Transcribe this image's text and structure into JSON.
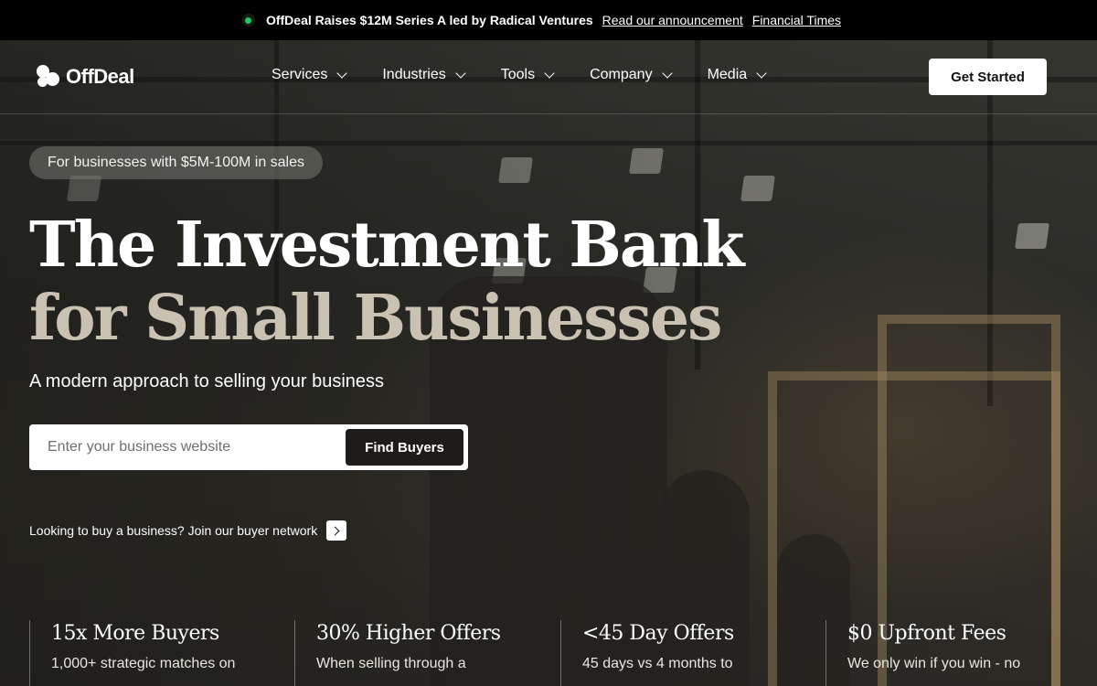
{
  "announcement": {
    "headline": "OffDeal Raises $12M Series A led by Radical Ventures",
    "link1": "Read our announcement",
    "link2": "Financial Times"
  },
  "nav": {
    "logo_text": "OffDeal",
    "items": [
      {
        "label": "Services"
      },
      {
        "label": "Industries"
      },
      {
        "label": "Tools"
      },
      {
        "label": "Company"
      },
      {
        "label": "Media"
      }
    ],
    "cta_label": "Get Started"
  },
  "hero": {
    "badge": "For businesses with $5M-100M in sales",
    "title_line1": "The Investment Bank",
    "title_line2": "for Small Businesses",
    "subtitle": "A modern approach to selling your business",
    "search_placeholder": "Enter your business website",
    "search_button": "Find Buyers",
    "buyer_link": "Looking to buy a business? Join our buyer network"
  },
  "stats": [
    {
      "title": "15x More Buyers",
      "text": "1,000+ strategic matches on"
    },
    {
      "title": "30% Higher Offers",
      "text": "When selling through a"
    },
    {
      "title": "<45 Day Offers",
      "text": "45 days vs 4 months to"
    },
    {
      "title": "$0 Upfront Fees",
      "text": "We only win if you win - no"
    }
  ]
}
